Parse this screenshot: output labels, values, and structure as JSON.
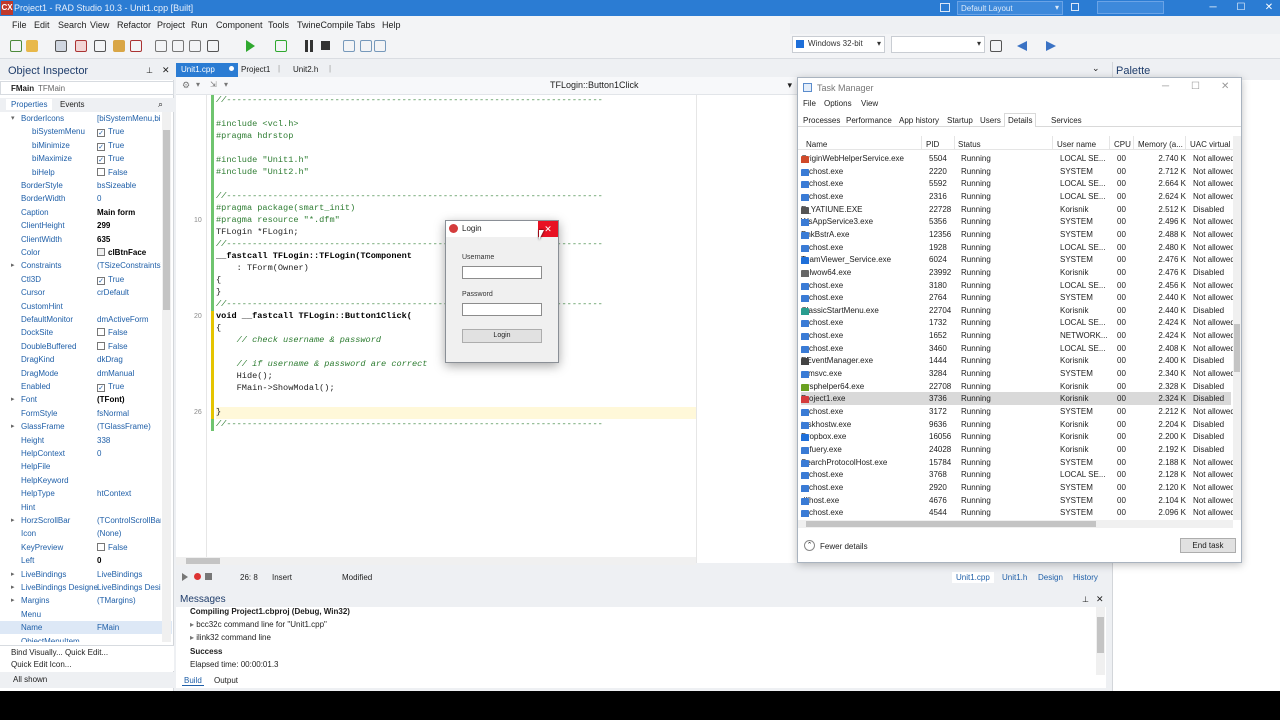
{
  "window": {
    "title": "Project1 - RAD Studio 10.3 - Unit1.cpp [Built]",
    "logo": "CX"
  },
  "menu": [
    "File",
    "Edit",
    "Search",
    "View",
    "Refactor",
    "Project",
    "Run",
    "Component",
    "Tools",
    "TwineCompile",
    "Tabs",
    "Help"
  ],
  "toolbar": {
    "platform": "Windows 32-bit",
    "layout": "Default Layout"
  },
  "object_inspector": {
    "title": "Object Inspector",
    "component": "FMain",
    "component_type": "TFMain",
    "tabs": [
      "Properties",
      "Events"
    ],
    "rows": [
      {
        "name": "BorderIcons",
        "value": "[biSystemMenu,biMi",
        "level": 0,
        "expand": "-"
      },
      {
        "name": "biSystemMenu",
        "value": "True",
        "level": 1,
        "check": true
      },
      {
        "name": "biMinimize",
        "value": "True",
        "level": 1,
        "check": true
      },
      {
        "name": "biMaximize",
        "value": "True",
        "level": 1,
        "check": true
      },
      {
        "name": "biHelp",
        "value": "False",
        "level": 1,
        "check": false
      },
      {
        "name": "BorderStyle",
        "value": "bsSizeable",
        "level": 0
      },
      {
        "name": "BorderWidth",
        "value": "0",
        "level": 0
      },
      {
        "name": "Caption",
        "value": "Main form",
        "level": 0,
        "bold": true
      },
      {
        "name": "ClientHeight",
        "value": "299",
        "level": 0,
        "bold": true
      },
      {
        "name": "ClientWidth",
        "value": "635",
        "level": 0,
        "bold": true
      },
      {
        "name": "Color",
        "value": "clBtnFace",
        "level": 0,
        "bold": true,
        "swatch": "#f0f0f0"
      },
      {
        "name": "Constraints",
        "value": "(TSizeConstraints)",
        "level": 0,
        "expand": "+"
      },
      {
        "name": "Ctl3D",
        "value": "True",
        "level": 0,
        "check": true
      },
      {
        "name": "Cursor",
        "value": "crDefault",
        "level": 0
      },
      {
        "name": "CustomHint",
        "value": "",
        "level": 0
      },
      {
        "name": "DefaultMonitor",
        "value": "dmActiveForm",
        "level": 0
      },
      {
        "name": "DockSite",
        "value": "False",
        "level": 0,
        "check": false
      },
      {
        "name": "DoubleBuffered",
        "value": "False",
        "level": 0,
        "check": false
      },
      {
        "name": "DragKind",
        "value": "dkDrag",
        "level": 0
      },
      {
        "name": "DragMode",
        "value": "dmManual",
        "level": 0
      },
      {
        "name": "Enabled",
        "value": "True",
        "level": 0,
        "check": true
      },
      {
        "name": "Font",
        "value": "(TFont)",
        "level": 0,
        "expand": "+",
        "bold": true
      },
      {
        "name": "FormStyle",
        "value": "fsNormal",
        "level": 0
      },
      {
        "name": "GlassFrame",
        "value": "(TGlassFrame)",
        "level": 0,
        "expand": "+"
      },
      {
        "name": "Height",
        "value": "338",
        "level": 0
      },
      {
        "name": "HelpContext",
        "value": "0",
        "level": 0
      },
      {
        "name": "HelpFile",
        "value": "",
        "level": 0
      },
      {
        "name": "HelpKeyword",
        "value": "",
        "level": 0
      },
      {
        "name": "HelpType",
        "value": "htContext",
        "level": 0
      },
      {
        "name": "Hint",
        "value": "",
        "level": 0
      },
      {
        "name": "HorzScrollBar",
        "value": "(TControlScrollBar",
        "level": 0,
        "expand": "+"
      },
      {
        "name": "Icon",
        "value": "(None)",
        "level": 0
      },
      {
        "name": "KeyPreview",
        "value": "False",
        "level": 0,
        "check": false
      },
      {
        "name": "Left",
        "value": "0",
        "level": 0,
        "bold": true
      },
      {
        "name": "LiveBindings",
        "value": "LiveBindings",
        "level": 0,
        "expand": "+"
      },
      {
        "name": "LiveBindings Designe",
        "value": "LiveBindings Desi",
        "level": 0,
        "expand": "+"
      },
      {
        "name": "Margins",
        "value": "(TMargins)",
        "level": 0,
        "expand": "+"
      },
      {
        "name": "Menu",
        "value": "",
        "level": 0
      },
      {
        "name": "Name",
        "value": "FMain",
        "level": 0,
        "selected": true
      },
      {
        "name": "ObjectMenuItem",
        "value": "",
        "level": 0
      }
    ],
    "footer_links": "Bind Visually...  Quick Edit...",
    "footer_link2": "Quick Edit Icon...",
    "footer_status": "All shown"
  },
  "editor": {
    "tabs": [
      "Unit1.cpp",
      "Project1",
      "Unit2.h"
    ],
    "method_combo": "TFLogin::Button1Click",
    "lines": [
      {
        "t": "//-------------------------------------------------------------------------",
        "c": "cm"
      },
      {
        "t": "",
        "c": ""
      },
      {
        "t": "#include <vcl.h>",
        "c": "pp"
      },
      {
        "t": "#pragma hdrstop",
        "c": "pp"
      },
      {
        "t": "",
        "c": ""
      },
      {
        "t": "#include \"Unit1.h\"",
        "c": "pp"
      },
      {
        "t": "#include \"Unit2.h\"",
        "c": "pp"
      },
      {
        "t": "",
        "c": ""
      },
      {
        "t": "//-------------------------------------------------------------------------",
        "c": "cm"
      },
      {
        "t": "#pragma package(smart_init)",
        "c": "pp"
      },
      {
        "t": "#pragma resource \"*.dfm\"",
        "c": "pp"
      },
      {
        "t": "TFLogin *FLogin;",
        "c": ""
      },
      {
        "t": "//-------------------------------------------------------------------------",
        "c": "cm"
      },
      {
        "t": "__fastcall TFLogin::TFLogin(TComponent",
        "c": "kw"
      },
      {
        "t": "    : TForm(Owner)",
        "c": ""
      },
      {
        "t": "{",
        "c": ""
      },
      {
        "t": "}",
        "c": ""
      },
      {
        "t": "//-------------------------------------------------------------------------",
        "c": "cm"
      },
      {
        "t": "void __fastcall TFLogin::Button1Click(",
        "c": "kw"
      },
      {
        "t": "{",
        "c": ""
      },
      {
        "t": "    // check username & password",
        "c": "cm"
      },
      {
        "t": "",
        "c": ""
      },
      {
        "t": "    // if username & password are correct",
        "c": "cm"
      },
      {
        "t": "    Hide();",
        "c": ""
      },
      {
        "t": "    FMain->ShowModal();",
        "c": ""
      },
      {
        "t": "",
        "c": ""
      },
      {
        "t": "}",
        "c": ""
      },
      {
        "t": "//-------------------------------------------------------------------------",
        "c": "cm"
      }
    ],
    "gutter": [
      {
        "line": 10,
        "label": "10"
      },
      {
        "line": 18,
        "label": "20"
      },
      {
        "line": 26,
        "label": "26"
      }
    ],
    "status": {
      "pos": "26:  8",
      "mode": "Insert",
      "state": "Modified"
    },
    "bottom_tabs": [
      "Unit1.cpp",
      "Unit1.h",
      "Design",
      "History"
    ]
  },
  "login": {
    "title": "Login",
    "username_label": "Username",
    "password_label": "Password",
    "button": "Login"
  },
  "messages": {
    "title": "Messages",
    "lines": [
      {
        "t": "Compiling Project1.cbproj (Debug, Win32)",
        "bold": true
      },
      {
        "t": "bcc32c command line for \"Unit1.cpp\"",
        "expand": true
      },
      {
        "t": "ilink32 command line",
        "expand": true
      },
      {
        "t": "Success",
        "bold": true
      },
      {
        "t": "Elapsed time: 00:00:01.3",
        "bold": false
      }
    ],
    "tabs": [
      "Build",
      "Output"
    ]
  },
  "palette": {
    "title": "Palette"
  },
  "task_manager": {
    "title": "Task Manager",
    "menu": [
      "File",
      "Options",
      "View"
    ],
    "tabs": [
      "Processes",
      "Performance",
      "App history",
      "Startup",
      "Users",
      "Details",
      "Services"
    ],
    "active_tab": "Details",
    "columns": [
      "Name",
      "PID",
      "Status",
      "User name",
      "CPU",
      "Memory (a...",
      "UAC virtual"
    ],
    "rows": [
      [
        "OriginWebHelperService.exe",
        "5504",
        "Running",
        "LOCAL SE...",
        "00",
        "2.740 K",
        "Not allowed",
        "#d04a2a"
      ],
      [
        "svchost.exe",
        "2220",
        "Running",
        "SYSTEM",
        "00",
        "2.712 K",
        "Not allowed",
        "#3a7bd5"
      ],
      [
        "svchost.exe",
        "5592",
        "Running",
        "LOCAL SE...",
        "00",
        "2.664 K",
        "Not allowed",
        "#3a7bd5"
      ],
      [
        "svchost.exe",
        "2316",
        "Running",
        "LOCAL SE...",
        "00",
        "2.624 K",
        "Not allowed",
        "#3a7bd5"
      ],
      [
        "E_YATIUNE.EXE",
        "22728",
        "Running",
        "Korisnik",
        "00",
        "2.512 K",
        "Disabled",
        "#555555"
      ],
      [
        "WsAppService3.exe",
        "5356",
        "Running",
        "SYSTEM",
        "00",
        "2.496 K",
        "Not allowed",
        "#3a7bd5"
      ],
      [
        "PnkBstrA.exe",
        "12356",
        "Running",
        "SYSTEM",
        "00",
        "2.488 K",
        "Not allowed",
        "#3a7bd5"
      ],
      [
        "svchost.exe",
        "1928",
        "Running",
        "LOCAL SE...",
        "00",
        "2.480 K",
        "Not allowed",
        "#3a7bd5"
      ],
      [
        "TeamViewer_Service.exe",
        "6024",
        "Running",
        "SYSTEM",
        "00",
        "2.476 K",
        "Not allowed",
        "#1e6fd9"
      ],
      [
        "splwow64.exe",
        "23992",
        "Running",
        "Korisnik",
        "00",
        "2.476 K",
        "Disabled",
        "#666666"
      ],
      [
        "svchost.exe",
        "3180",
        "Running",
        "LOCAL SE...",
        "00",
        "2.456 K",
        "Not allowed",
        "#3a7bd5"
      ],
      [
        "svchost.exe",
        "2764",
        "Running",
        "SYSTEM",
        "00",
        "2.440 K",
        "Not allowed",
        "#3a7bd5"
      ],
      [
        "ClassicStartMenu.exe",
        "22704",
        "Running",
        "Korisnik",
        "00",
        "2.440 K",
        "Disabled",
        "#2a9d8f"
      ],
      [
        "svchost.exe",
        "1732",
        "Running",
        "LOCAL SE...",
        "00",
        "2.424 K",
        "Not allowed",
        "#3a7bd5"
      ],
      [
        "svchost.exe",
        "1652",
        "Running",
        "NETWORK...",
        "00",
        "2.424 K",
        "Not allowed",
        "#3a7bd5"
      ],
      [
        "svchost.exe",
        "3460",
        "Running",
        "LOCAL SE...",
        "00",
        "2.408 K",
        "Not allowed",
        "#3a7bd5"
      ],
      [
        "EEventManager.exe",
        "1444",
        "Running",
        "Korisnik",
        "00",
        "2.400 K",
        "Disabled",
        "#444444"
      ],
      [
        "armsvc.exe",
        "3284",
        "Running",
        "SYSTEM",
        "00",
        "2.340 K",
        "Not allowed",
        "#3a7bd5"
      ],
      [
        "nvsphelper64.exe",
        "22708",
        "Running",
        "Korisnik",
        "00",
        "2.328 K",
        "Disabled",
        "#6aa121"
      ],
      [
        "Project1.exe",
        "3736",
        "Running",
        "Korisnik",
        "00",
        "2.324 K",
        "Disabled",
        "#d43c3c"
      ],
      [
        "svchost.exe",
        "3172",
        "Running",
        "SYSTEM",
        "00",
        "2.212 K",
        "Not allowed",
        "#3a7bd5"
      ],
      [
        "taskhostw.exe",
        "9636",
        "Running",
        "Korisnik",
        "00",
        "2.204 K",
        "Disabled",
        "#3a7bd5"
      ],
      [
        "Dropbox.exe",
        "16056",
        "Running",
        "Korisnik",
        "00",
        "2.200 K",
        "Disabled",
        "#1e6fd9"
      ],
      [
        "cqfuery.exe",
        "24028",
        "Running",
        "Korisnik",
        "00",
        "2.192 K",
        "Disabled",
        "#3a7bd5"
      ],
      [
        "SearchProtocolHost.exe",
        "15784",
        "Running",
        "SYSTEM",
        "00",
        "2.188 K",
        "Not allowed",
        "#3a7bd5"
      ],
      [
        "svchost.exe",
        "3768",
        "Running",
        "LOCAL SE...",
        "00",
        "2.128 K",
        "Not allowed",
        "#3a7bd5"
      ],
      [
        "svchost.exe",
        "2920",
        "Running",
        "SYSTEM",
        "00",
        "2.120 K",
        "Not allowed",
        "#3a7bd5"
      ],
      [
        "dllhost.exe",
        "4676",
        "Running",
        "SYSTEM",
        "00",
        "2.104 K",
        "Not allowed",
        "#3a7bd5"
      ],
      [
        "svchost.exe",
        "4544",
        "Running",
        "SYSTEM",
        "00",
        "2.096 K",
        "Not allowed",
        "#3a7bd5"
      ]
    ],
    "selected_row": 19,
    "fewer_details": "Fewer details",
    "end_task": "End task"
  }
}
